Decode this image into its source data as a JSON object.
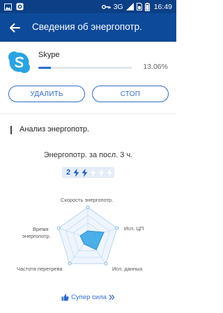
{
  "status_bar": {
    "network": "3G",
    "time": "16:49",
    "icons": [
      "image-icon",
      "app-notification-icon",
      "key-icon",
      "signal-icon",
      "sim-icon",
      "battery-icon"
    ]
  },
  "app_bar": {
    "title": "Сведения об энергопотр.",
    "back_icon": "arrow-left-icon"
  },
  "app": {
    "name": "Skype",
    "usage_percent": "13.06%",
    "usage_fraction": 0.1306,
    "icon": "skype-icon"
  },
  "actions": {
    "delete_label": "УДАЛИТЬ",
    "stop_label": "СТОП"
  },
  "analysis": {
    "section_title": "Анализ энергопотр.",
    "usage_label": "Энергопотр. за посл. 3 ч.",
    "level": "2",
    "level_active": 2,
    "level_total": 5,
    "radar_labels": {
      "speed": "Скорость энергопотр.",
      "cpu": "Исп. ЦП",
      "data": "Исп. данных",
      "overheat": "Частота перегрева",
      "time_line1": "Время",
      "time_line2": "энергопотр."
    }
  },
  "footer": {
    "super_power_label": "Супер сила",
    "icons": [
      "thumbs-up-icon",
      "double-chevron-right-icon"
    ]
  },
  "colors": {
    "status_bar": "#0b3f86",
    "app_bar": "#0d4a9a",
    "accent": "#2f6ccb",
    "radar_fill": "#3aa7e6"
  }
}
